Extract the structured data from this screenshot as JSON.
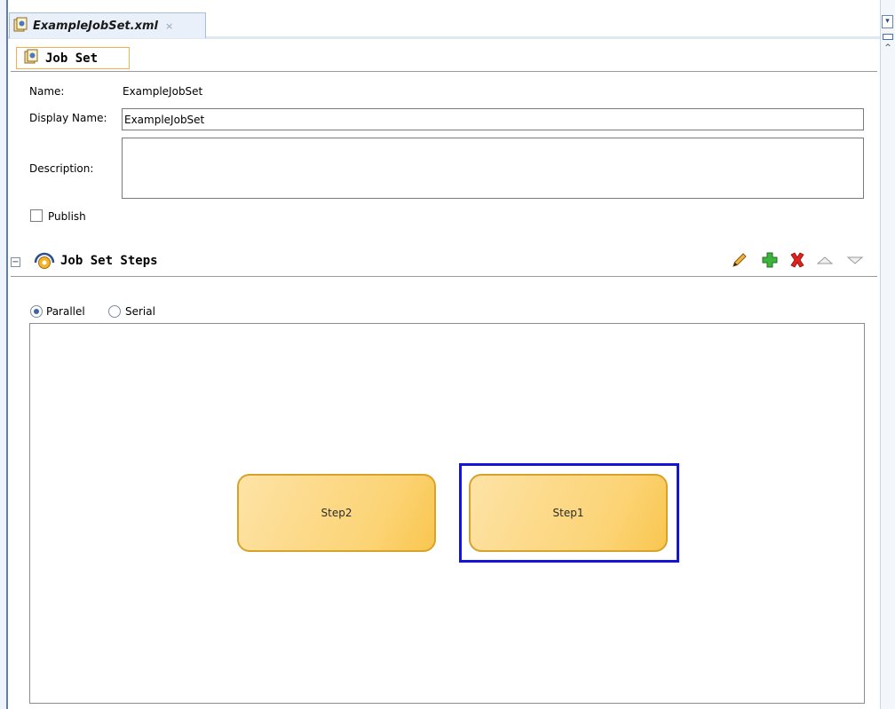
{
  "editor": {
    "tab_label": "ExampleJobSet.xml",
    "tab_close": "×"
  },
  "jobset": {
    "section_title": "Job Set",
    "name_label": "Name:",
    "name_value": "ExampleJobSet",
    "display_name_label": "Display Name:",
    "display_name_value": "ExampleJobSet",
    "description_label": "Description:",
    "description_value": "",
    "publish_label": "Publish",
    "publish_checked": false
  },
  "steps": {
    "section_title": "Job Set Steps",
    "collapse_glyph": "−",
    "toolbar": {
      "edit_icon": "pencil-icon",
      "add_icon": "green-plus-icon",
      "delete_icon": "red-x-icon",
      "move_up_icon": "triangle-up-icon",
      "move_down_icon": "triangle-down-icon"
    },
    "mode_parallel_label": "Parallel",
    "mode_serial_label": "Serial",
    "selected_mode": "Parallel",
    "nodes": [
      {
        "label": "Step2",
        "selected": false
      },
      {
        "label": "Step1",
        "selected": true
      }
    ]
  },
  "colors": {
    "selection_border": "#1515d8",
    "node_fill": "#fcd476",
    "node_border": "#d7a32b",
    "tab_highlight": "#f0b24f"
  }
}
